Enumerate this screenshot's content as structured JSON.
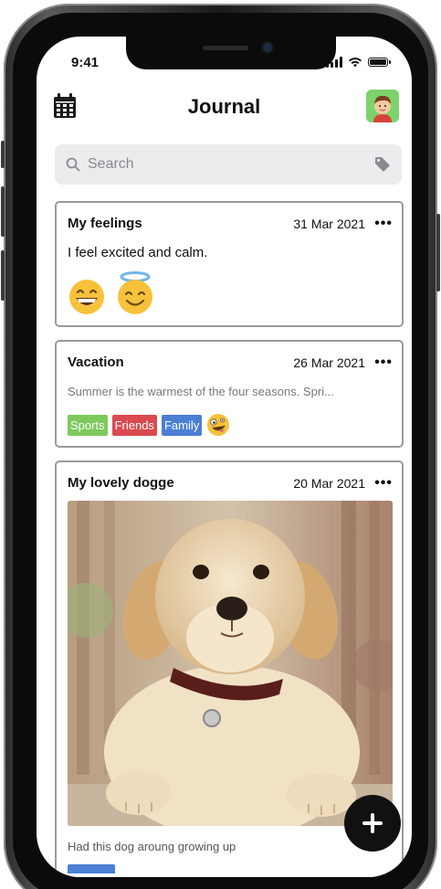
{
  "status_bar": {
    "time": "9:41"
  },
  "header": {
    "title": "Journal"
  },
  "search": {
    "placeholder": "Search"
  },
  "entries": [
    {
      "title": "My feelings",
      "date": "31 Mar 2021",
      "more": "•••",
      "text": "I feel excited and calm.",
      "emojis": [
        "grinning-face-emoji",
        "smiling-face-with-halo-emoji"
      ]
    },
    {
      "title": "Vacation",
      "date": "26 Mar 2021",
      "more": "•••",
      "snippet": "Summer is the warmest of the four seasons. Spri...",
      "tags": [
        {
          "label": "Sports",
          "color": "#7dc95e"
        },
        {
          "label": "Friends",
          "color": "#d94a4f"
        },
        {
          "label": "Family",
          "color": "#4a7fd4"
        }
      ],
      "emoji": "zany-face-emoji"
    },
    {
      "title": "My lovely dogge",
      "date": "20 Mar 2021",
      "more": "•••",
      "image": "golden-retriever-puppy-photo",
      "caption": "Had this dog aroung growing up"
    }
  ],
  "fab": {
    "icon": "plus-icon"
  }
}
